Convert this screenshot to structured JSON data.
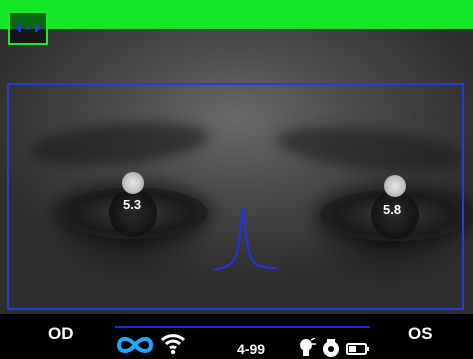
{
  "readings": {
    "left_pupil": "5.3",
    "right_pupil": "5.8"
  },
  "status_bar": {
    "od_label": "OD",
    "os_label": "OS",
    "device_id": "4-99"
  },
  "icons": {
    "mode": "arrows-horizontal-icon",
    "pair": "infinity-link-icon",
    "wifi": "wifi-icon",
    "light": "flash-icon",
    "camera": "camera-icon",
    "battery": "battery-icon"
  },
  "colors": {
    "top_bar": "#15e625",
    "roi_frame": "#2b3bd8",
    "pulse_trace": "#2233ee",
    "status_accent": "#1ea7ff"
  }
}
